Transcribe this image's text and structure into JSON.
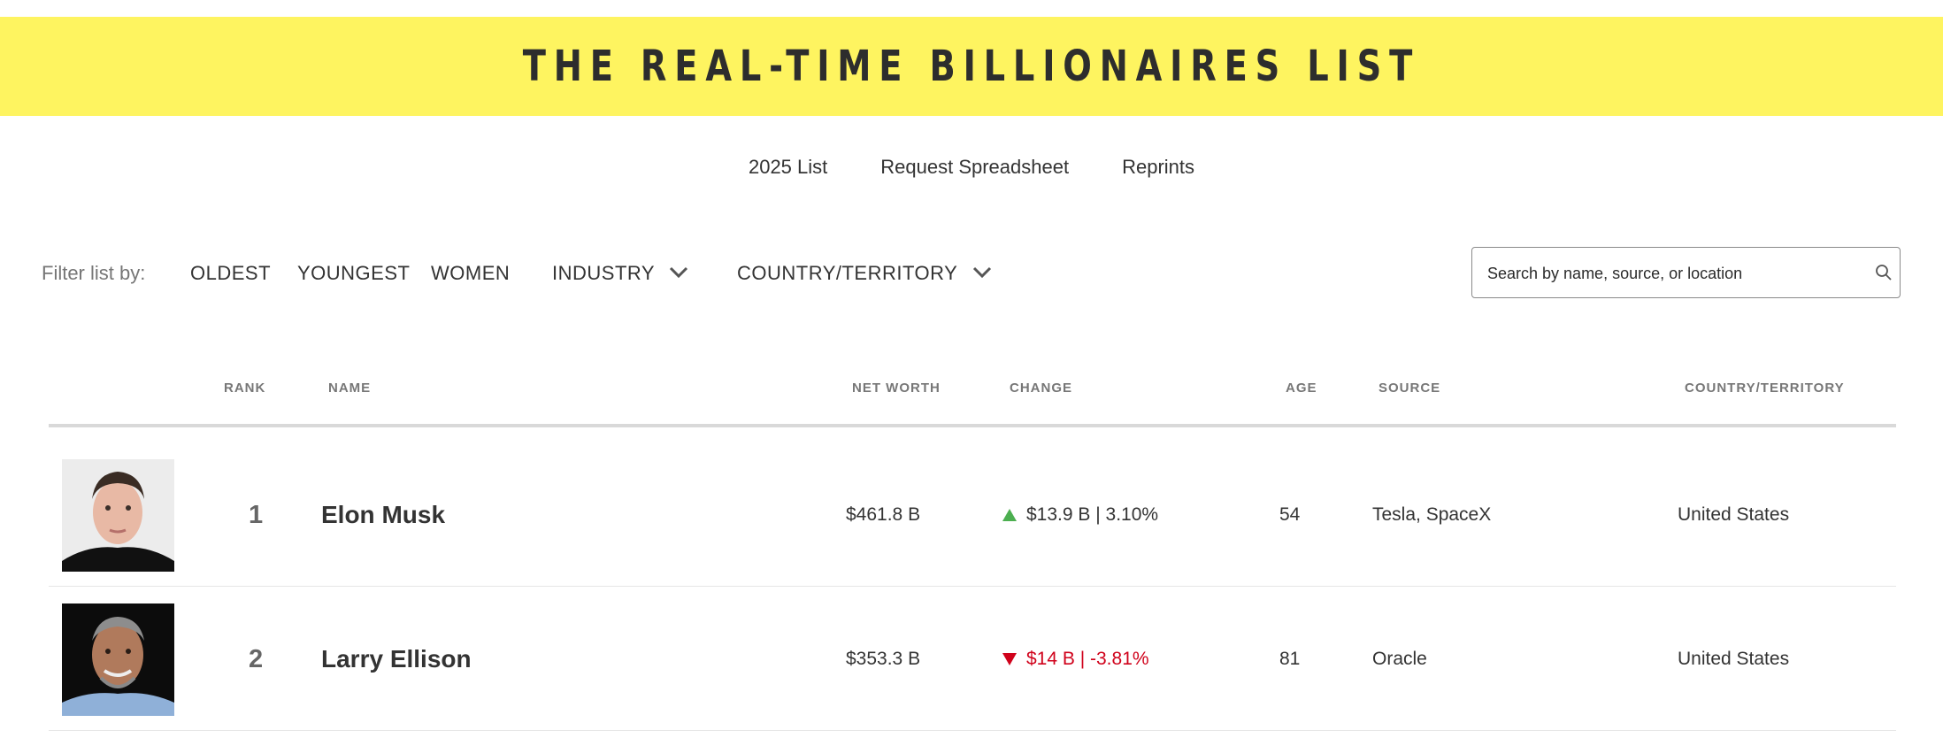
{
  "banner": {
    "title": "THE REAL-TIME BILLIONAIRES LIST"
  },
  "subnav": {
    "items": [
      "2025 List",
      "Request Spreadsheet",
      "Reprints"
    ]
  },
  "filters": {
    "label": "Filter list by:",
    "oldest": "OLDEST",
    "youngest": "YOUNGEST",
    "women": "WOMEN",
    "industry": "INDUSTRY",
    "country": "COUNTRY/TERRITORY"
  },
  "search": {
    "placeholder": "Search by name, source, or location"
  },
  "table": {
    "headers": {
      "rank": "RANK",
      "name": "NAME",
      "net_worth": "NET WORTH",
      "change": "CHANGE",
      "age": "AGE",
      "source": "SOURCE",
      "country": "COUNTRY/TERRITORY"
    },
    "rows": [
      {
        "rank": "1",
        "name": "Elon Musk",
        "net_worth": "$461.8 B",
        "change": "$13.9 B | 3.10%",
        "direction": "up",
        "age": "54",
        "source": "Tesla, SpaceX",
        "country": "United States"
      },
      {
        "rank": "2",
        "name": "Larry Ellison",
        "net_worth": "$353.3 B",
        "change": "$14 B | -3.81%",
        "direction": "down",
        "age": "81",
        "source": "Oracle",
        "country": "United States"
      }
    ]
  },
  "colors": {
    "banner": "#fef460",
    "up": "#4caf50",
    "down": "#d0021b"
  }
}
